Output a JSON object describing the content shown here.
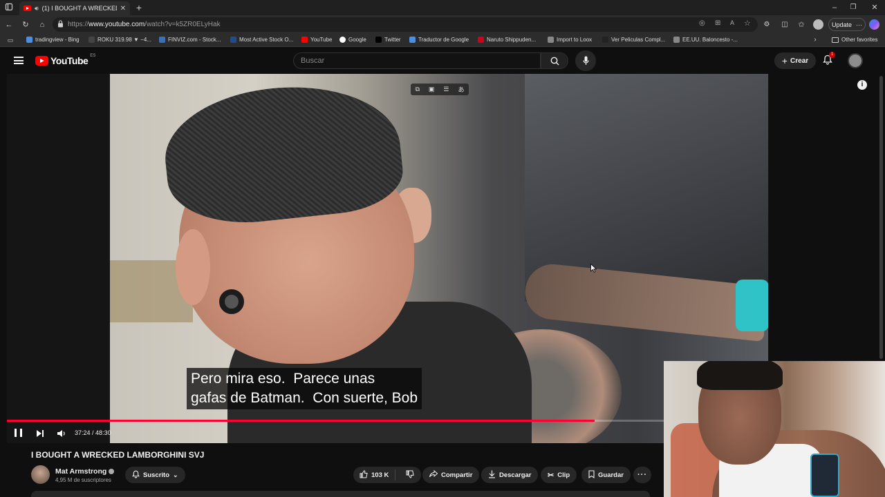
{
  "browser": {
    "tab_title": "(1) I BOUGHT A WRECKED L...",
    "url_prefix": "https://",
    "url_host": "www.youtube.com",
    "url_path": "/watch?v=k5ZR0ELyHak",
    "update_label": "Update",
    "other_favorites": "Other favorites"
  },
  "bookmarks": [
    {
      "label": "tradingview - Bing",
      "icon": "search-icon",
      "color": "#4a8fe0"
    },
    {
      "label": "ROKU 319.98 ▼ −4...",
      "icon": "ticker-icon",
      "color": "#444444"
    },
    {
      "label": "FINVIZ.com - Stock...",
      "icon": "globe-icon",
      "color": "#3b6fb6"
    },
    {
      "label": "Most Active Stock O...",
      "icon": "page-icon",
      "color": "#1f4e8c"
    },
    {
      "label": "YouTube",
      "icon": "youtube-icon",
      "color": "#ff0000"
    },
    {
      "label": "Google",
      "icon": "google-icon",
      "color": "#ffffff"
    },
    {
      "label": "Twitter",
      "icon": "x-icon",
      "color": "#000000"
    },
    {
      "label": "Traductor de Google",
      "icon": "translate-icon",
      "color": "#4a8fe0"
    },
    {
      "label": "Naruto Shippuden...",
      "icon": "s-icon",
      "color": "#d0021b"
    },
    {
      "label": "Import to Loox",
      "icon": "globe-icon",
      "color": "#888888"
    },
    {
      "label": "Ver Peliculas Compl...",
      "icon": "shield-icon",
      "color": "#222222"
    },
    {
      "label": "EE.UU. Baloncesto -...",
      "icon": "page-icon",
      "color": "#888888"
    }
  ],
  "youtube": {
    "logo_text": "YouTube",
    "region": "ES",
    "search_placeholder": "Buscar",
    "create_label": "Crear",
    "notif_count": "1"
  },
  "video": {
    "subtitle_line1": "Pero mira eso.  Parece unas",
    "subtitle_line2": "gafas de Batman.  Con suerte, Bob",
    "time_current": "37:24",
    "time_separator": " / ",
    "time_total": "48:30",
    "progress": 0.771,
    "accent_color": "#ff0033"
  },
  "meta": {
    "title": "I BOUGHT A WRECKED LAMBORGHINI SVJ",
    "channel": "Mat Armstrong",
    "subscribers": "4,95 M de suscriptores",
    "subscribed_label": "Suscrito",
    "likes": "103 K",
    "share_label": "Compartir",
    "download_label": "Descargar",
    "clip_label": "Clip",
    "save_label": "Guardar"
  }
}
